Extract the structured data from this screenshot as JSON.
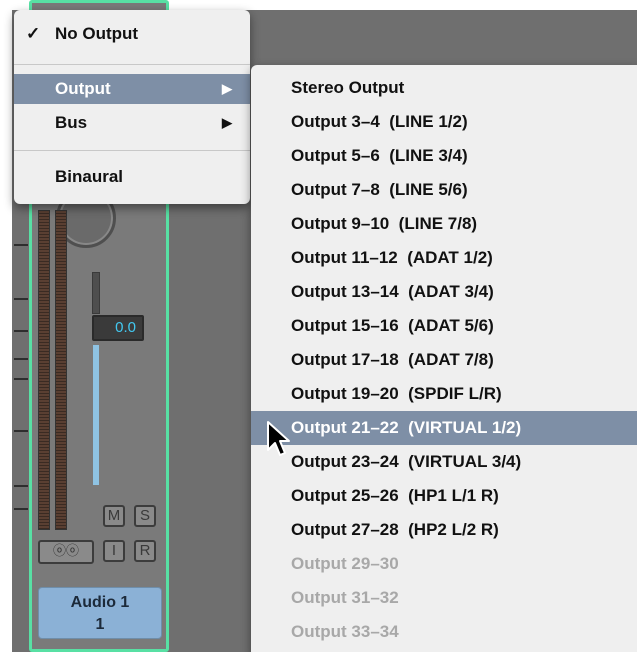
{
  "mixer": {
    "volume": "0.0",
    "mute_label": "M",
    "solo_label": "S",
    "input_label": "I",
    "record_label": "R",
    "link_glyph": "ⓞⓞ",
    "track_name_line1": "Audio 1",
    "track_name_line2": "1"
  },
  "output_menu": {
    "items": [
      {
        "label": "No Output",
        "check": "✓"
      },
      {
        "label": "Output",
        "arrow": "▶"
      },
      {
        "label": "Bus",
        "arrow": "▶"
      },
      {
        "label": "Binaural"
      }
    ]
  },
  "output_submenu": {
    "items": [
      {
        "label": "Stereo Output",
        "enabled": true
      },
      {
        "label": "Output 3–4  (LINE 1/2)",
        "enabled": true
      },
      {
        "label": "Output 5–6  (LINE 3/4)",
        "enabled": true
      },
      {
        "label": "Output 7–8  (LINE 5/6)",
        "enabled": true
      },
      {
        "label": "Output 9–10  (LINE 7/8)",
        "enabled": true
      },
      {
        "label": "Output 11–12  (ADAT 1/2)",
        "enabled": true
      },
      {
        "label": "Output 13–14  (ADAT 3/4)",
        "enabled": true
      },
      {
        "label": "Output 15–16  (ADAT 5/6)",
        "enabled": true
      },
      {
        "label": "Output 17–18  (ADAT 7/8)",
        "enabled": true
      },
      {
        "label": "Output 19–20  (SPDIF L/R)",
        "enabled": true
      },
      {
        "label": "Output 21–22  (VIRTUAL 1/2)",
        "enabled": true
      },
      {
        "label": "Output 23–24  (VIRTUAL 3/4)",
        "enabled": true
      },
      {
        "label": "Output 25–26  (HP1 L/1 R)",
        "enabled": true
      },
      {
        "label": "Output 27–28  (HP2 L/2 R)",
        "enabled": true
      },
      {
        "label": "Output 29–30",
        "enabled": false
      },
      {
        "label": "Output 31–32",
        "enabled": false
      },
      {
        "label": "Output 33–34",
        "enabled": false
      }
    ]
  },
  "colors": {
    "highlight": "#7e8fa6",
    "strip_border": "#58e0a4",
    "track_name_bg": "#8bb1d6",
    "volume_text": "#42c8f0"
  }
}
